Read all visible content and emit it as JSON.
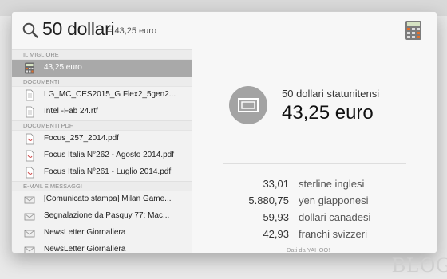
{
  "search": {
    "query": "50 dollari",
    "inline_result": "= 43,25 euro"
  },
  "sections": [
    {
      "header": "IL MIGLIORE",
      "items": [
        {
          "label": "43,25 euro",
          "icon": "calculator-icon",
          "selected": true
        }
      ]
    },
    {
      "header": "DOCUMENTI",
      "items": [
        {
          "label": "LG_MC_CES2015_G Flex2_5gen2...",
          "icon": "document-icon"
        },
        {
          "label": "Intel -Fab 24.rtf",
          "icon": "document-icon"
        }
      ]
    },
    {
      "header": "DOCUMENTI PDF",
      "items": [
        {
          "label": "Focus_257_2014.pdf",
          "icon": "pdf-icon"
        },
        {
          "label": "Focus Italia N°262 - Agosto 2014.pdf",
          "icon": "pdf-icon"
        },
        {
          "label": "Focus Italia N°261 - Luglio 2014.pdf",
          "icon": "pdf-icon"
        }
      ]
    },
    {
      "header": "E-MAIL E MESSAGGI",
      "items": [
        {
          "label": "[Comunicato stampa] Milan Game...",
          "icon": "mail-icon"
        },
        {
          "label": "Segnalazione da Pasquy 77: Mac...",
          "icon": "mail-icon"
        },
        {
          "label": "NewsLetter Giornaliera",
          "icon": "mail-icon"
        },
        {
          "label": "NewsLetter Giornaliera",
          "icon": "mail-icon"
        }
      ]
    }
  ],
  "preview": {
    "from_label": "50 dollari statunitensi",
    "to_value": "43,25 euro",
    "conversions": [
      {
        "value": "33,01",
        "currency": "sterline inglesi"
      },
      {
        "value": "5.880,75",
        "currency": "yen giapponesi"
      },
      {
        "value": "59,93",
        "currency": "dollari canadesi"
      },
      {
        "value": "42,93",
        "currency": "franchi svizzeri"
      }
    ],
    "source": "Dati da YAHOO!"
  },
  "watermark": "BLOG",
  "colors": {
    "selected_row": "#a9a9a9",
    "currency_icon_bg": "#a3a3a3",
    "calculator_accent": "#e26f2c"
  }
}
